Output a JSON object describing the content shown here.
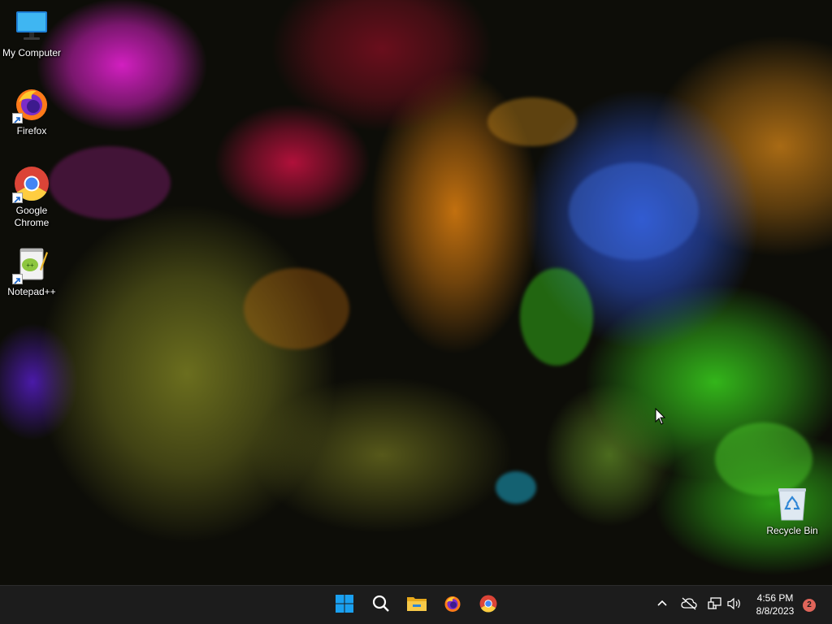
{
  "desktop": {
    "icons": [
      {
        "label": "My Computer",
        "icon": "monitor-icon"
      },
      {
        "label": "Firefox",
        "icon": "firefox-icon"
      },
      {
        "label": "Google Chrome",
        "icon": "chrome-icon"
      },
      {
        "label": "Notepad++",
        "icon": "notepad-plus-plus-icon"
      },
      {
        "label": "Recycle Bin",
        "icon": "recycle-bin-icon"
      }
    ]
  },
  "taskbar": {
    "pinned": [
      {
        "name": "Start",
        "icon": "windows-start-icon"
      },
      {
        "name": "Search",
        "icon": "search-icon"
      },
      {
        "name": "File Explorer",
        "icon": "folder-icon"
      },
      {
        "name": "Firefox",
        "icon": "firefox-icon"
      },
      {
        "name": "Google Chrome",
        "icon": "chrome-icon"
      }
    ],
    "tray": {
      "icons": [
        "chevron-up-icon",
        "cloud-offline-icon",
        "network-icon",
        "volume-icon"
      ],
      "time": "4:56 PM",
      "date": "8/8/2023",
      "notification_count": "2"
    }
  },
  "colors": {
    "taskbar_bg": "#1c1c1c",
    "start_blue": "#1aa0f0",
    "badge": "#e0655a"
  }
}
